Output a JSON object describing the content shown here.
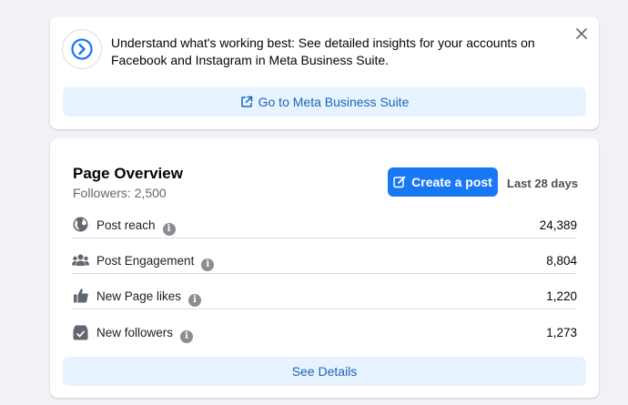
{
  "promo": {
    "text": "Understand what's working best: See detailed insights for your accounts on Facebook and Instagram in Meta Business Suite.",
    "button_label": "Go to Meta Business Suite",
    "logo_icon": "meta-business-suite-icon"
  },
  "overview": {
    "title": "Page Overview",
    "followers": "Followers: 2,500",
    "create_label": "Create a post",
    "range_label": "Last 28 days",
    "details_label": "See Details",
    "metrics": [
      {
        "icon": "globe-icon",
        "label": "Post reach",
        "value": "24,389"
      },
      {
        "icon": "people-icon",
        "label": "Post Engagement",
        "value": "8,804"
      },
      {
        "icon": "thumbs-up-icon",
        "label": "New Page likes",
        "value": "1,220"
      },
      {
        "icon": "inbox-check-icon",
        "label": "New followers",
        "value": "1,273"
      }
    ]
  },
  "colors": {
    "accent": "#1877f2",
    "link": "#1b64b8",
    "soft_button_bg": "#e7f3ff",
    "background": "#f0f2f5"
  }
}
